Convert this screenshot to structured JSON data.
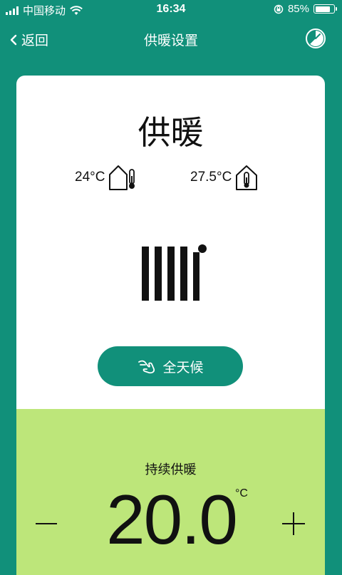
{
  "status_bar": {
    "carrier": "中国移动",
    "time": "16:34",
    "battery_text": "85%",
    "battery_level": 0.85
  },
  "nav": {
    "back_label": "返回",
    "title": "供暖设置"
  },
  "card": {
    "mode_title": "供暖",
    "indoor_temp": "24°C",
    "outdoor_temp": "27.5°C",
    "schedule_label": "全天候"
  },
  "setpoint": {
    "label": "持续供暖",
    "value": "20.0",
    "unit": "°C"
  },
  "colors": {
    "brand_teal": "#11907a",
    "panel_green": "#bde67a"
  }
}
